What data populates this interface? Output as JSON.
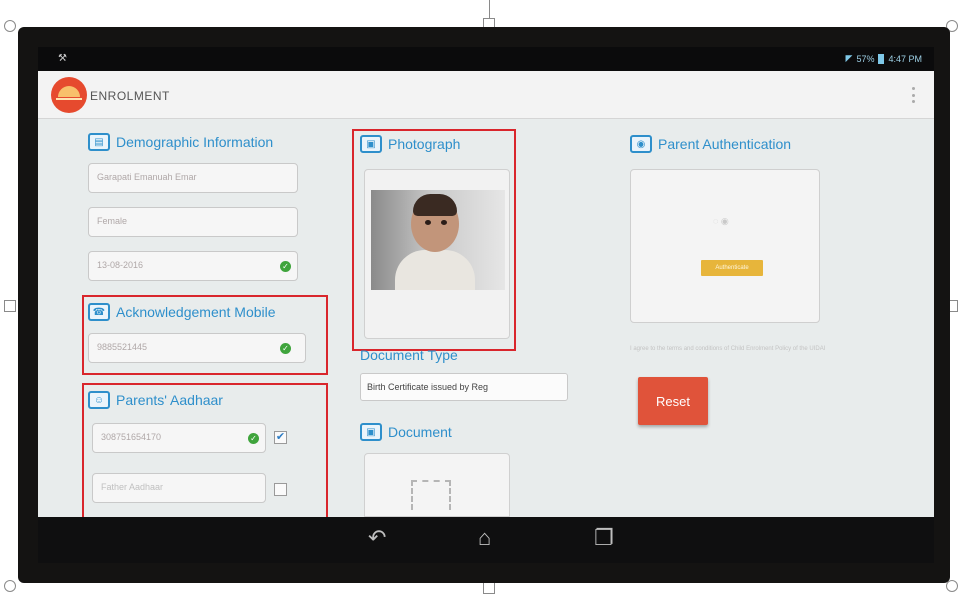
{
  "status_bar": {
    "left_icon": "wrench-icon",
    "battery": "57%",
    "time": "4:47 PM"
  },
  "app_bar": {
    "title": "ENROLMENT",
    "logo_icon": "aadhaar-sun-logo",
    "overflow_icon": "overflow-menu-icon"
  },
  "demographic": {
    "title": "Demographic Information",
    "icon": "id-card-icon",
    "name_value": "Garapati Emanuah Emar",
    "gender_value": "Female",
    "dob_value": "13-08-2016",
    "dob_verified": true
  },
  "ack_mobile": {
    "title": "Acknowledgement Mobile",
    "icon": "phone-icon",
    "value": "9885521445",
    "verified": true
  },
  "parents_aadhaar": {
    "title": "Parents' Aadhaar",
    "icon": "family-icon",
    "mother_value": "308751654170",
    "mother_verified": true,
    "mother_checked": true,
    "father_placeholder": "Father Aadhaar",
    "father_checked": false
  },
  "photograph": {
    "title": "Photograph",
    "icon": "photo-icon"
  },
  "document_type": {
    "label": "Document Type",
    "selected": "Birth Certificate issued by Reg"
  },
  "document": {
    "title": "Document",
    "icon": "photo-icon"
  },
  "parent_auth": {
    "title": "Parent Authentication",
    "icon": "fingerprint-icon",
    "button_label": "Authenticate"
  },
  "terms_text": "I agree to the terms and conditions of Child Enrolment Policy of the UIDAI",
  "reset_label": "Reset",
  "nav": {
    "back_icon": "back-icon",
    "home_icon": "home-icon",
    "recents_icon": "recents-icon"
  },
  "colors": {
    "accent": "#2e8fcb",
    "highlight_box": "#d9262c",
    "reset_button": "#e0533a",
    "verified": "#3fa43c"
  }
}
